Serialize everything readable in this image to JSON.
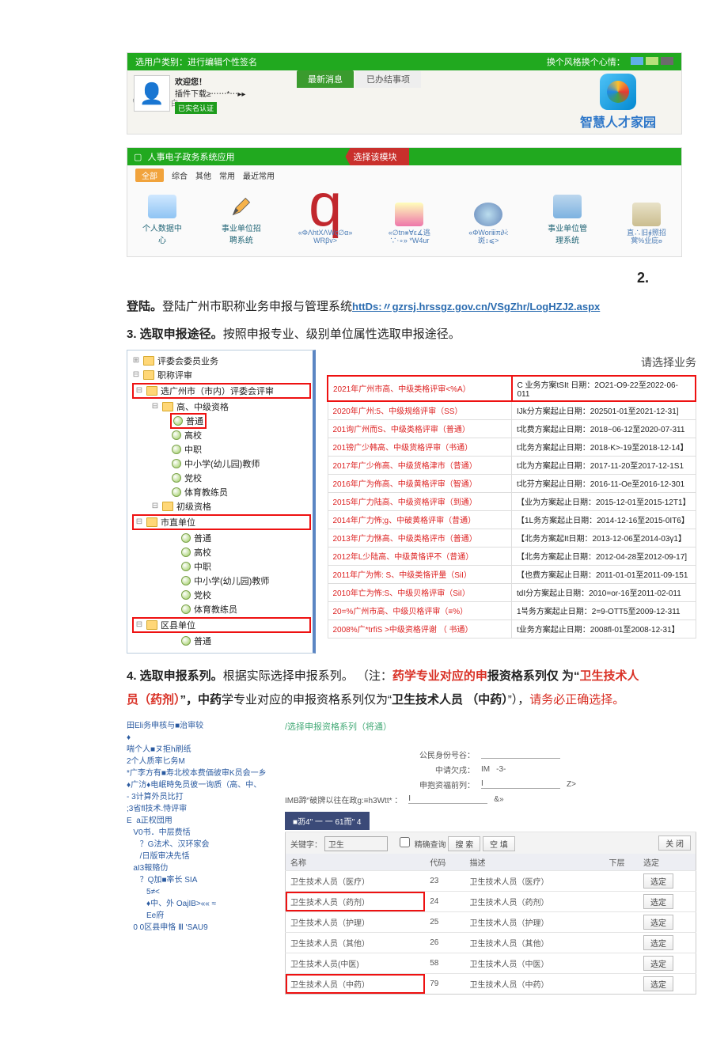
{
  "top_number": "2.",
  "shotA": {
    "bar_left": "选用户类别：进行编辑个性签名",
    "bar_right": "换个风格换个心情：",
    "search_placeholder": "由：*α白",
    "welcome": "欢迎您！",
    "welcome_sub": "插件下载≥⋯⋯*⋯▸▸",
    "cert": "已实名认证",
    "tab_news": "最新消息",
    "tab_done": "已办结事项",
    "brand": "智慧人才家园",
    "green_bar_left": "人事电子政务系统应用",
    "module_label": "选择该模块",
    "filter_all": "全部",
    "filter_items": [
      "综合",
      "其他",
      "常用",
      "最近常用"
    ],
    "apps": [
      {
        "label": "个人数据中心",
        "sub": ""
      },
      {
        "label": "事业单位招聘系统",
        "sub": ""
      },
      {
        "label": "",
        "sub": "«ΦΛhtΧΛWς∅α» WRβv>"
      },
      {
        "label": "",
        "sub": "«∅tn⨳∀ε∡逃∵⋅∘» *W4ur"
      },
      {
        "label": "",
        "sub": "«ΦWorⅲπ∂⩻斑↕⩽>"
      },
      {
        "label": "事业单位管理系统",
        "sub": ""
      },
      {
        "label": "直∴旧⨖照招蓂%业庇ⲑ",
        "sub": ""
      }
    ]
  },
  "step2": {
    "lead": "登陆。",
    "text": "登陆广州市职称业务申报与管理系统",
    "url": "httDs:〃gzrsj.hrssgz.gov.cn/VSgZhr/LogHZJ2.aspx"
  },
  "step3": {
    "lead": "3. 选取申报途径。",
    "text": "按照申报专业、级别单位属性选取申报途径。"
  },
  "tree": [
    {
      "ind": 0,
      "icon": "folder",
      "exp": "+",
      "label": "评委会委员业务"
    },
    {
      "ind": 0,
      "icon": "folder",
      "exp": "-",
      "label": "职称评审"
    },
    {
      "ind": 1,
      "icon": "folder",
      "exp": "-",
      "label": "选广州市（市内）评委会评审",
      "red": true
    },
    {
      "ind": 2,
      "icon": "folder",
      "exp": "-",
      "label": "高、中级资格"
    },
    {
      "ind": 3,
      "icon": "page",
      "label": "普通",
      "ring": true
    },
    {
      "ind": 3,
      "icon": "page",
      "label": "高校"
    },
    {
      "ind": 3,
      "icon": "page",
      "label": "中职"
    },
    {
      "ind": 3,
      "icon": "page",
      "label": "中小学(幼儿园)教师"
    },
    {
      "ind": 3,
      "icon": "page",
      "label": "党校"
    },
    {
      "ind": 3,
      "icon": "page",
      "label": "体育教练员"
    },
    {
      "ind": 2,
      "icon": "folder",
      "exp": "-",
      "label": "初级资格"
    },
    {
      "ind": 3,
      "icon": "folder",
      "exp": "-",
      "label": "市直单位",
      "red": true
    },
    {
      "ind": 4,
      "icon": "page",
      "label": "普通"
    },
    {
      "ind": 4,
      "icon": "page",
      "label": "高校"
    },
    {
      "ind": 4,
      "icon": "page",
      "label": "中职"
    },
    {
      "ind": 4,
      "icon": "page",
      "label": "中小学(幼儿园)教师"
    },
    {
      "ind": 4,
      "icon": "page",
      "label": "党校"
    },
    {
      "ind": 4,
      "icon": "page",
      "label": "体育教练员"
    },
    {
      "ind": 3,
      "icon": "folder",
      "exp": "-",
      "label": "区县单位",
      "red": true
    },
    {
      "ind": 4,
      "icon": "page",
      "label": "普通"
    }
  ],
  "biz_title": "请选择业务",
  "biz_rows": [
    {
      "l": "2021年广州市高、中级类格评审<%A）",
      "r": "C 业务方案tSIt 日期：2O21-O9-22至2022-06-011",
      "hi": true
    },
    {
      "l": "2020年广州:5、中级规络评审（SS）",
      "r": "IJk分方案起止日期：202501-01至2021-12-31]"
    },
    {
      "l": "201询广州而S、中级类格评审（普通）",
      "r": "t北费方案起止日期：2018~06-12至2020-07-311"
    },
    {
      "l": "201镑广少韩高、中级货格评审（书通）",
      "r": "t北务方案起止日期：2018-K>-19至2018-12-14】"
    },
    {
      "l": "2017年广少佈高、中级货格津市（昔通）",
      "r": "t北为方案起止日期：2017-11-20至2017-12-1S1"
    },
    {
      "l": "2016年广为佈高、中级黄格评审（智通）",
      "r": "t北芬方案起止日期：2016-11-Oe至2016-12-301"
    },
    {
      "l": "2015年广力陆高、中级资格评审（到通）",
      "r": "【业为方案起止日期：2015-12-01至2015-12T1】"
    },
    {
      "l": "2014年广力怖;g、中破黄格评审（昔通）",
      "r": "【1L务方案起止日期：2014-12-16至2015-0IT6】"
    },
    {
      "l": "2013年广力恘高、中级类格评市（普通）",
      "r": "【北务方案起It日期：2013-12-06至2014-03γ1】"
    },
    {
      "l": "2012年L少陆高、中级黄恪评不（昔通）",
      "r": "【北务方案起止日期：2012-04-28至2012-09-17]"
    },
    {
      "l": "2011年广为怖: S、中级类恪评量（SiI）",
      "r": "【也费方案起止日期：2011-01-01至2011-09-151"
    },
    {
      "l": "2010年亡为怖:S、中级贝格评审（SiI）",
      "r": "tdI分方案起止日期：2010=or-16至2011-02-011"
    },
    {
      "l": "20=%广州市高、中级贝格评审（≡%）",
      "r": "1북务方案起止日期：2=9-OTT5至2009-12-311"
    },
    {
      "l": "2008%广*trfiS >中级资格评谢 （ 书通）",
      "r": "t业务方案起止日期：2008fl-01至2008-12-31】"
    }
  ],
  "step4": {
    "lead": "4. 选取申报系列。",
    "t1": "根据实际选择申报系列。  （注：",
    "r1": "药学专业对应的申",
    "t2": "报资格系列仅  为“",
    "r2": "卫生技术人员（药剂）",
    "t3": "”，中药",
    "t4": "学专业对应的申报资格系列仅为“",
    "r3": "卫生技术人员  （中药）",
    "t5": "”），",
    "r4": "请务必正确选择。"
  },
  "shotC": {
    "tree_header": "田Eli务申核与■治审较",
    "tree_lines": [
      "♦",
      "喘个人■ヌ拒h刷纸",
      "2个人质率匕务M",
      "*广李方有■寿北校本费価彼审K员会一乡",
      "♦广汸♦电岷時免员彼一询质（高、中、",
      "- 3计算外员比打",
      ";3省fl技术.恃评审",
      "E  a正权団用",
      "   V0书．中层费恬",
      "      ？G法术、汉环家会",
      "      /日版审决先恬",
      "   aI3報赂仂",
      "      ？Q加■率长 SIA",
      "         5≠<",
      "         ♦中、外 OajIB>«« ≈",
      "         Ee府",
      "   0 0区县申恪 Ⅲ 'SAU9"
    ],
    "right_header": "/选择申报资格系列（将通）",
    "form": {
      "id_label": "公民身份号谷：",
      "level_label": "中请欠戌：",
      "level_value": "IM",
      "level_after": "-3-",
      "before_label": "申抱资福前列：",
      "before_val": "I",
      "before_after": "Z>",
      "imb_label": "IMB蹄″破牌以往在政g:≡h3Wtt* ：",
      "imb_val": "I",
      "imb_after": "&»"
    },
    "dark_tab": "■沥4\" 一 一 61而\" 4",
    "kw_label": "关键字：",
    "kw_value": "卫生",
    "chk_label": "精确查询",
    "btn_search": "搜 索",
    "btn_clear": "空 填",
    "btn_close": "关 闭",
    "cols": [
      "名称",
      "代码",
      "描述",
      "下层",
      "选定"
    ],
    "rows": [
      {
        "name": "卫生技术人员（医疗）",
        "code": "23",
        "desc": "卫生技术人员（医疗）",
        "btn": "选定"
      },
      {
        "name": "卫生技术人员（药剂）",
        "code": "24",
        "desc": "卫生技术人员（药剂）",
        "btn": "选定",
        "red": true
      },
      {
        "name": "卫生技术人员（护理）",
        "code": "25",
        "desc": "卫生技术人员（护理）",
        "btn": "选定"
      },
      {
        "name": "卫生技术人员（其他）",
        "code": "26",
        "desc": "卫生技术人员（其他）",
        "btn": "选定"
      },
      {
        "name": "卫生技术人员(中医)",
        "code": "58",
        "desc": "卫生技术人员（中医）",
        "btn": "选定"
      },
      {
        "name": "卫生技术人员（中药）",
        "code": "79",
        "desc": "卫生技术人员（中药）",
        "btn": "选定",
        "red": true
      }
    ]
  }
}
